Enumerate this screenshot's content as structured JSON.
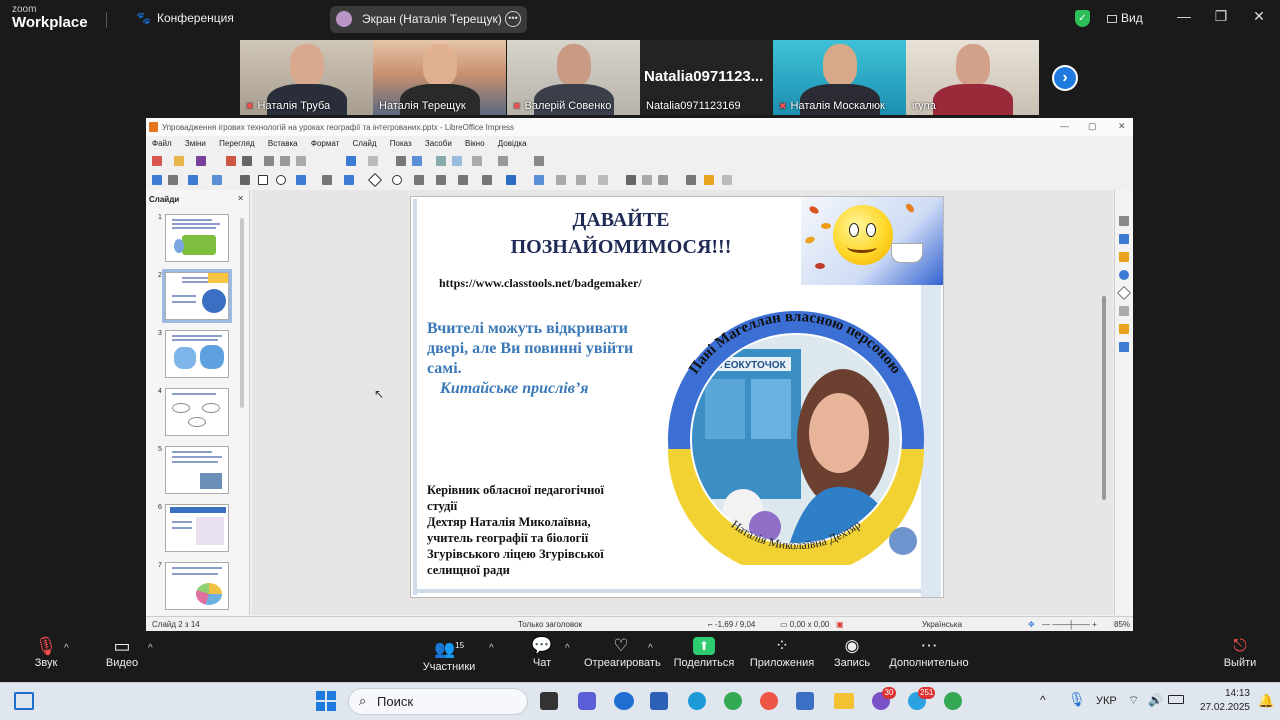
{
  "zoom": {
    "logo_line1": "zoom",
    "logo_line2": "Workplace",
    "meeting_label": "Конференция",
    "share_label": "Экран (Наталія Терещук)",
    "view_label": "Вид",
    "participants": [
      {
        "name": "Наталія Труба",
        "muted": true
      },
      {
        "name": "Наталія Терещук",
        "muted": false,
        "active": true
      },
      {
        "name": "Валерій Совенко",
        "muted": true
      },
      {
        "name": "Natalia0971123169",
        "big_name": "Natalia0971123...",
        "muted": false
      },
      {
        "name": "Наталія Москалюк",
        "muted": true
      },
      {
        "name": "iryna",
        "muted": false
      }
    ],
    "toolbar": {
      "audio": "Звук",
      "video": "Видео",
      "participants": "Участники",
      "participants_count": "15",
      "chat": "Чат",
      "react": "Отреагировать",
      "share": "Поделиться",
      "apps": "Приложения",
      "record": "Запись",
      "more": "Дополнительно",
      "leave": "Выйти"
    },
    "accent": "#2ecc71"
  },
  "libreoffice": {
    "window_title": "Упровадження ігрових технологій на уроках географії та інтегрованих.pptx - LibreOffice Impress",
    "menu": [
      "Файл",
      "Зміни",
      "Перегляд",
      "Вставка",
      "Формат",
      "Слайд",
      "Показ",
      "Засоби",
      "Вікно",
      "Довідка"
    ],
    "slides_panel_title": "Слайди",
    "slide_numbers": [
      "1",
      "2",
      "3",
      "4",
      "5",
      "6",
      "7"
    ],
    "status": {
      "slide": "Слайд 2 з 14",
      "layout": "Только заголовок",
      "position": "-1,69 / 9,04",
      "size": "0,00 x 0,00",
      "language": "Українська",
      "zoom": "85%"
    }
  },
  "slide": {
    "title": "ДАВАЙТЕ ПОЗНАЙОМИМОСЯ!!!",
    "url": "https://www.classtools.net/badgemaker/",
    "quote": "Вчителі можуть відкривати двері, але Ви повинні увійти самі.",
    "quote_author": "Китайське прислів’я",
    "author_role": "Керівник обласної педагогічної студії",
    "author_name": "Дехтяр Наталія Миколаївна,",
    "author_job": "учитель географії та біології",
    "author_school": "Згурівського ліцею Згурівської селищної ради",
    "badge_top_text": "Пані Магеллан власною персоною",
    "badge_bottom_text": "Наталія Миколаївна Дехтяр",
    "board_label": "МЕТЕОКУТОЧОК"
  },
  "taskbar": {
    "search": "Поиск",
    "language": "УКР",
    "time": "14:13",
    "date": "27.02.2025",
    "badge_viber": "30",
    "badge_telegram": "251"
  }
}
